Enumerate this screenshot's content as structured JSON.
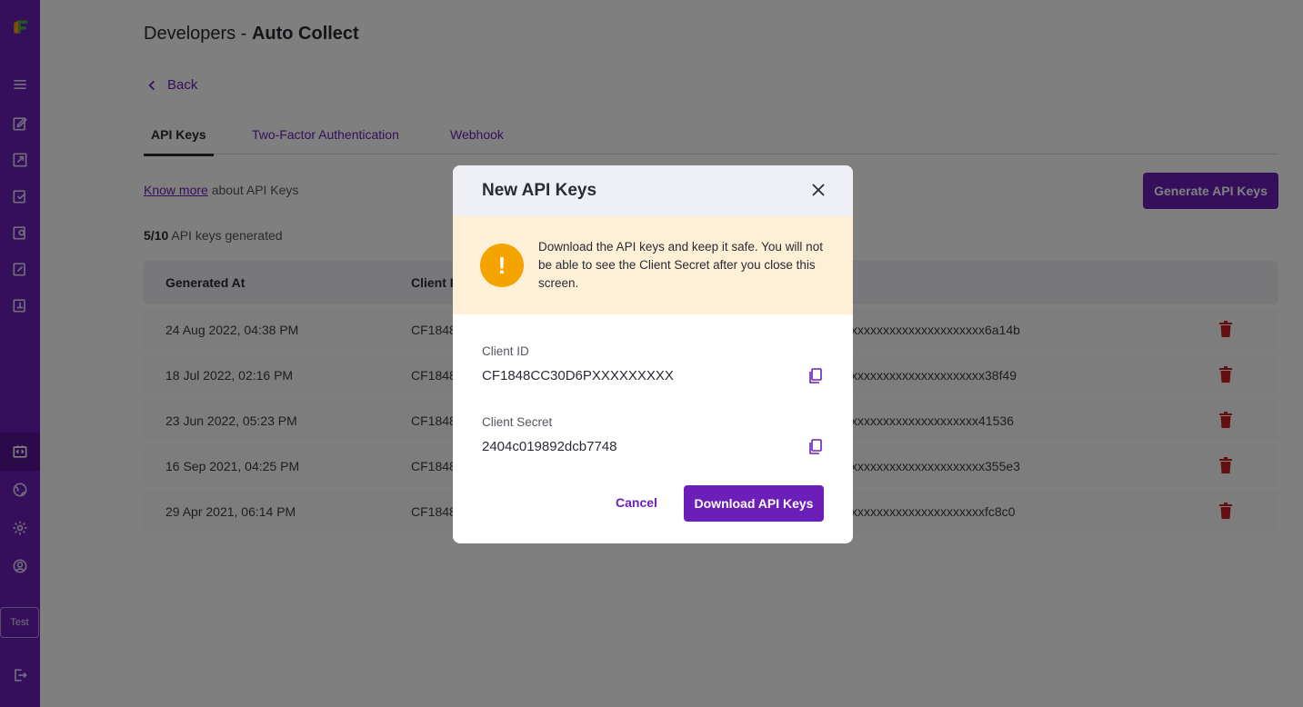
{
  "sidebar": {
    "env_label": "Test"
  },
  "page": {
    "title_prefix": "Developers - ",
    "title_main": "Auto Collect",
    "back_label": "Back",
    "tabs": [
      {
        "label": "API Keys"
      },
      {
        "label": "Two-Factor Authentication"
      },
      {
        "label": "Webhook"
      }
    ],
    "know_more_link": "Know more",
    "know_more_suffix": " about API Keys",
    "keys_count": "5/10",
    "keys_count_suffix": " API keys generated",
    "generate_button": "Generate API Keys"
  },
  "table": {
    "headers": [
      "Generated At",
      "Client I"
    ],
    "rows": [
      {
        "generated_at": "24 Aug 2022, 04:38 PM",
        "client_id": "CF1848",
        "secret": "xxxxxxxxxxxxxxxxxxxxx6a14b"
      },
      {
        "generated_at": "18 Jul 2022, 02:16 PM",
        "client_id": "CF1848",
        "secret": "xxxxxxxxxxxxxxxxxxxxx38f49"
      },
      {
        "generated_at": "23 Jun 2022, 05:23 PM",
        "client_id": "CF1848",
        "secret": "xxxxxxxxxxxxxxxxxxxx41536"
      },
      {
        "generated_at": "16 Sep 2021, 04:25 PM",
        "client_id": "CF1848",
        "secret": "xxxxxxxxxxxxxxxxxxxxx355e3"
      },
      {
        "generated_at": "29 Apr 2021, 06:14 PM",
        "client_id": "CF1848",
        "secret": "xxxxxxxxxxxxxxxxxxxxxfc8c0"
      }
    ]
  },
  "modal": {
    "title": "New API Keys",
    "warning_text": "Download the API keys and keep it safe. You will not be able to see the Client Secret after you close this screen.",
    "warning_symbol": "!",
    "client_id_label": "Client ID",
    "client_id_value": "CF1848CC30D6PXXXXXXXXX",
    "client_secret_label": "Client Secret",
    "client_secret_value": "2404c019892dcb7748",
    "cancel_label": "Cancel",
    "download_label": "Download API Keys"
  },
  "colors": {
    "brand_purple": "#6b1fb8",
    "warning_bg": "#fdf0d6",
    "warning_icon": "#f5a300",
    "delete_red": "#c81e1e"
  }
}
